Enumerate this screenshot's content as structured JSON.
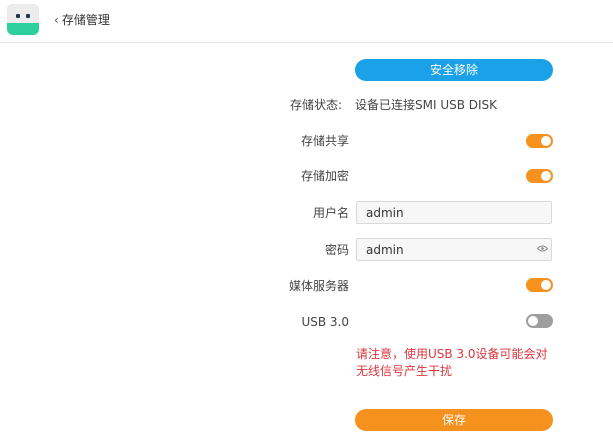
{
  "header": {
    "back_label": "存储管理"
  },
  "actions": {
    "remove_label": "安全移除",
    "save_label": "保存"
  },
  "status": {
    "label": "存储状态:",
    "value": "设备已连接SMI USB DISK"
  },
  "settings": {
    "share": {
      "label": "存储共享",
      "enabled": true
    },
    "encrypt": {
      "label": "存储加密",
      "enabled": true
    },
    "username": {
      "label": "用户名",
      "value": "admin"
    },
    "password": {
      "label": "密码",
      "value": "admin"
    },
    "media_server": {
      "label": "媒体服务器",
      "enabled": true
    },
    "usb3": {
      "label": "USB 3.0",
      "enabled": false
    }
  },
  "warning": "请注意，使用USB 3.0设备可能会对无线信号产生干扰",
  "colors": {
    "accent_orange": "#f7911e",
    "accent_blue": "#1ba1e8",
    "logo_green": "#2ecf9e",
    "warning_red": "#d9363e"
  },
  "icons": {
    "logo": "router-app-logo",
    "back": "chevron-left-icon",
    "password_toggle": "eye-icon"
  }
}
